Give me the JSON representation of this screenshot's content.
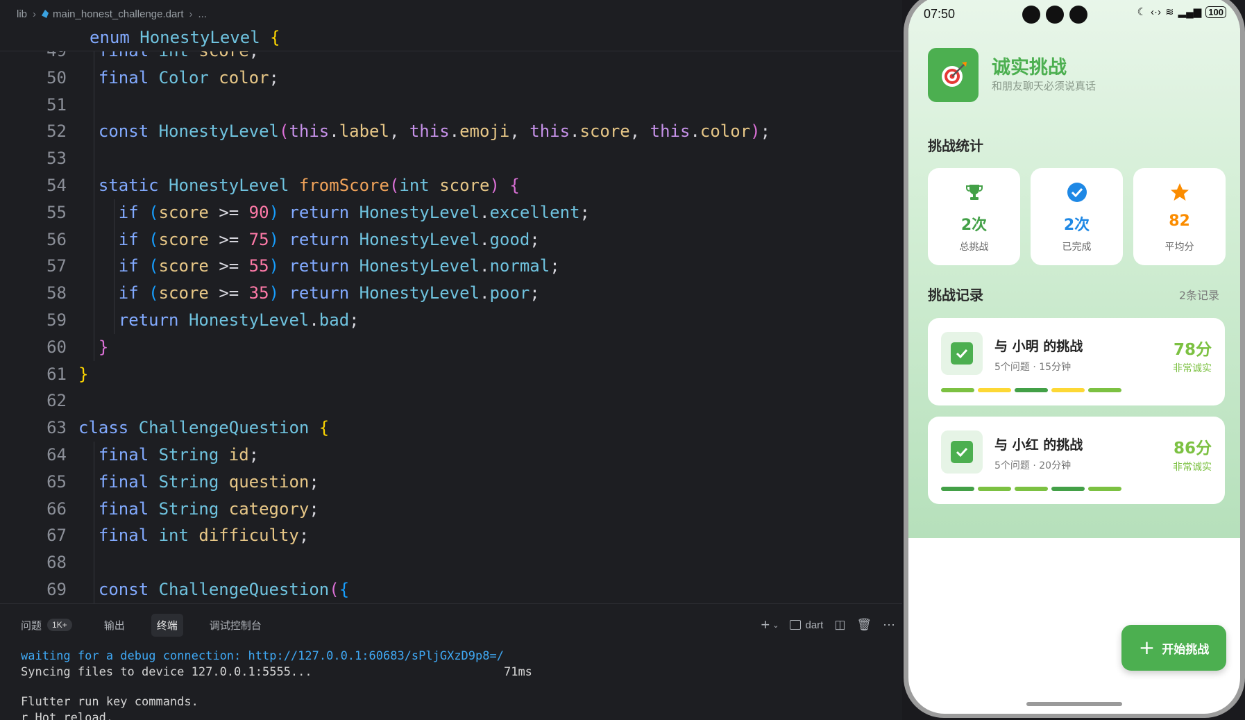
{
  "ide": {
    "breadcrumb": {
      "folder": "lib",
      "file": "main_honest_challenge.dart",
      "rest": "..."
    },
    "sticky_line": [
      {
        "t": "enum ",
        "c": "kw"
      },
      {
        "t": "HonestyLevel ",
        "c": "ty"
      },
      {
        "t": "{",
        "c": "b1"
      }
    ],
    "code_lines": [
      {
        "n": "49",
        "indent": 1,
        "tokens": [
          {
            "t": "final ",
            "c": "kw"
          },
          {
            "t": "int ",
            "c": "ty"
          },
          {
            "t": "score",
            "c": "vr"
          },
          {
            "t": ";",
            "c": "pl"
          }
        ]
      },
      {
        "n": "50",
        "indent": 1,
        "tokens": [
          {
            "t": "final ",
            "c": "kw"
          },
          {
            "t": "Color ",
            "c": "ty"
          },
          {
            "t": "color",
            "c": "vr"
          },
          {
            "t": ";",
            "c": "pl"
          }
        ]
      },
      {
        "n": "51",
        "indent": 1,
        "tokens": []
      },
      {
        "n": "52",
        "indent": 1,
        "tokens": [
          {
            "t": "const ",
            "c": "kw"
          },
          {
            "t": "HonestyLevel",
            "c": "ty"
          },
          {
            "t": "(",
            "c": "b2"
          },
          {
            "t": "this",
            "c": "th"
          },
          {
            "t": ".",
            "c": "pl"
          },
          {
            "t": "label",
            "c": "vr"
          },
          {
            "t": ", ",
            "c": "pl"
          },
          {
            "t": "this",
            "c": "th"
          },
          {
            "t": ".",
            "c": "pl"
          },
          {
            "t": "emoji",
            "c": "vr"
          },
          {
            "t": ", ",
            "c": "pl"
          },
          {
            "t": "this",
            "c": "th"
          },
          {
            "t": ".",
            "c": "pl"
          },
          {
            "t": "score",
            "c": "vr"
          },
          {
            "t": ", ",
            "c": "pl"
          },
          {
            "t": "this",
            "c": "th"
          },
          {
            "t": ".",
            "c": "pl"
          },
          {
            "t": "color",
            "c": "vr"
          },
          {
            "t": ")",
            "c": "b2"
          },
          {
            "t": ";",
            "c": "pl"
          }
        ]
      },
      {
        "n": "53",
        "indent": 1,
        "tokens": []
      },
      {
        "n": "54",
        "indent": 1,
        "tokens": [
          {
            "t": "static ",
            "c": "kw"
          },
          {
            "t": "HonestyLevel ",
            "c": "ty"
          },
          {
            "t": "fromScore",
            "c": "fn"
          },
          {
            "t": "(",
            "c": "b2"
          },
          {
            "t": "int ",
            "c": "ty"
          },
          {
            "t": "score",
            "c": "vr"
          },
          {
            "t": ") ",
            "c": "b2"
          },
          {
            "t": "{",
            "c": "b2"
          }
        ]
      },
      {
        "n": "55",
        "indent": 2,
        "tokens": [
          {
            "t": "if ",
            "c": "kw"
          },
          {
            "t": "(",
            "c": "b3"
          },
          {
            "t": "score ",
            "c": "vr"
          },
          {
            "t": ">= ",
            "c": "pl"
          },
          {
            "t": "90",
            "c": "num"
          },
          {
            "t": ") ",
            "c": "b3"
          },
          {
            "t": "return ",
            "c": "kw"
          },
          {
            "t": "HonestyLevel",
            "c": "ty"
          },
          {
            "t": ".",
            "c": "pl"
          },
          {
            "t": "excellent",
            "c": "ty"
          },
          {
            "t": ";",
            "c": "pl"
          }
        ]
      },
      {
        "n": "56",
        "indent": 2,
        "tokens": [
          {
            "t": "if ",
            "c": "kw"
          },
          {
            "t": "(",
            "c": "b3"
          },
          {
            "t": "score ",
            "c": "vr"
          },
          {
            "t": ">= ",
            "c": "pl"
          },
          {
            "t": "75",
            "c": "num"
          },
          {
            "t": ") ",
            "c": "b3"
          },
          {
            "t": "return ",
            "c": "kw"
          },
          {
            "t": "HonestyLevel",
            "c": "ty"
          },
          {
            "t": ".",
            "c": "pl"
          },
          {
            "t": "good",
            "c": "ty"
          },
          {
            "t": ";",
            "c": "pl"
          }
        ]
      },
      {
        "n": "57",
        "indent": 2,
        "tokens": [
          {
            "t": "if ",
            "c": "kw"
          },
          {
            "t": "(",
            "c": "b3"
          },
          {
            "t": "score ",
            "c": "vr"
          },
          {
            "t": ">= ",
            "c": "pl"
          },
          {
            "t": "55",
            "c": "num"
          },
          {
            "t": ") ",
            "c": "b3"
          },
          {
            "t": "return ",
            "c": "kw"
          },
          {
            "t": "HonestyLevel",
            "c": "ty"
          },
          {
            "t": ".",
            "c": "pl"
          },
          {
            "t": "normal",
            "c": "ty"
          },
          {
            "t": ";",
            "c": "pl"
          }
        ]
      },
      {
        "n": "58",
        "indent": 2,
        "tokens": [
          {
            "t": "if ",
            "c": "kw"
          },
          {
            "t": "(",
            "c": "b3"
          },
          {
            "t": "score ",
            "c": "vr"
          },
          {
            "t": ">= ",
            "c": "pl"
          },
          {
            "t": "35",
            "c": "num"
          },
          {
            "t": ") ",
            "c": "b3"
          },
          {
            "t": "return ",
            "c": "kw"
          },
          {
            "t": "HonestyLevel",
            "c": "ty"
          },
          {
            "t": ".",
            "c": "pl"
          },
          {
            "t": "poor",
            "c": "ty"
          },
          {
            "t": ";",
            "c": "pl"
          }
        ]
      },
      {
        "n": "59",
        "indent": 2,
        "tokens": [
          {
            "t": "return ",
            "c": "kw"
          },
          {
            "t": "HonestyLevel",
            "c": "ty"
          },
          {
            "t": ".",
            "c": "pl"
          },
          {
            "t": "bad",
            "c": "ty"
          },
          {
            "t": ";",
            "c": "pl"
          }
        ]
      },
      {
        "n": "60",
        "indent": 1,
        "tokens": [
          {
            "t": "}",
            "c": "b2"
          }
        ]
      },
      {
        "n": "61",
        "indent": 0,
        "tokens": [
          {
            "t": "}",
            "c": "b1"
          }
        ]
      },
      {
        "n": "62",
        "indent": 0,
        "tokens": []
      },
      {
        "n": "63",
        "indent": 0,
        "tokens": [
          {
            "t": "class ",
            "c": "kw"
          },
          {
            "t": "ChallengeQuestion ",
            "c": "ty"
          },
          {
            "t": "{",
            "c": "b1"
          }
        ]
      },
      {
        "n": "64",
        "indent": 1,
        "tokens": [
          {
            "t": "final ",
            "c": "kw"
          },
          {
            "t": "String ",
            "c": "ty"
          },
          {
            "t": "id",
            "c": "vr"
          },
          {
            "t": ";",
            "c": "pl"
          }
        ]
      },
      {
        "n": "65",
        "indent": 1,
        "tokens": [
          {
            "t": "final ",
            "c": "kw"
          },
          {
            "t": "String ",
            "c": "ty"
          },
          {
            "t": "question",
            "c": "vr"
          },
          {
            "t": ";",
            "c": "pl"
          }
        ]
      },
      {
        "n": "66",
        "indent": 1,
        "tokens": [
          {
            "t": "final ",
            "c": "kw"
          },
          {
            "t": "String ",
            "c": "ty"
          },
          {
            "t": "category",
            "c": "vr"
          },
          {
            "t": ";",
            "c": "pl"
          }
        ]
      },
      {
        "n": "67",
        "indent": 1,
        "tokens": [
          {
            "t": "final ",
            "c": "kw"
          },
          {
            "t": "int ",
            "c": "ty"
          },
          {
            "t": "difficulty",
            "c": "vr"
          },
          {
            "t": ";",
            "c": "pl"
          }
        ]
      },
      {
        "n": "68",
        "indent": 1,
        "tokens": []
      },
      {
        "n": "69",
        "indent": 1,
        "tokens": [
          {
            "t": "const ",
            "c": "kw"
          },
          {
            "t": "ChallengeQuestion",
            "c": "ty"
          },
          {
            "t": "(",
            "c": "b2"
          },
          {
            "t": "{",
            "c": "b3"
          }
        ]
      }
    ],
    "panel": {
      "tabs": [
        {
          "label": "问题",
          "badge": "1K+"
        },
        {
          "label": "输出",
          "badge": ""
        },
        {
          "label": "终端",
          "badge": "",
          "active": true
        },
        {
          "label": "调试控制台",
          "badge": ""
        }
      ],
      "terminal_name": "dart",
      "terminal_lines": [
        {
          "text": "waiting for a debug connection: http://127.0.0.1:60683/sPljGXzD9p8=/",
          "color": "blue"
        },
        {
          "text": "Syncing files to device 127.0.0.1:5555...                           71ms",
          "color": ""
        },
        {
          "text": "",
          "color": ""
        },
        {
          "text": "Flutter run key commands.",
          "color": ""
        },
        {
          "text": "r Hot reload.",
          "color": ""
        }
      ]
    }
  },
  "phone": {
    "status": {
      "time": "07:50",
      "battery": "100"
    },
    "app": {
      "title": "诚实挑战",
      "subtitle": "和朋友聊天必须说真话"
    },
    "stats": {
      "title": "挑战统计",
      "cards": [
        {
          "icon": "trophy-icon",
          "value": "2次",
          "label": "总挑战",
          "color": "#43a047"
        },
        {
          "icon": "check-circle-icon",
          "value": "2次",
          "label": "已完成",
          "color": "#1e88e5"
        },
        {
          "icon": "star-icon",
          "value": "82",
          "label": "平均分",
          "color": "#fb8c00"
        }
      ]
    },
    "records": {
      "title": "挑战记录",
      "count": "2条记录",
      "items": [
        {
          "title": "与 小明 的挑战",
          "meta": "5个问题 · 15分钟",
          "score": "78分",
          "level": "非常诚实",
          "bars": [
            "#7cc142",
            "#fdd835",
            "#43a047",
            "#fdd835",
            "#7cc142"
          ]
        },
        {
          "title": "与 小红 的挑战",
          "meta": "5个问题 · 20分钟",
          "score": "86分",
          "level": "非常诚实",
          "bars": [
            "#43a047",
            "#7cc142",
            "#7cc142",
            "#43a047",
            "#7cc142"
          ]
        }
      ]
    },
    "fab": {
      "label": "开始挑战"
    }
  }
}
